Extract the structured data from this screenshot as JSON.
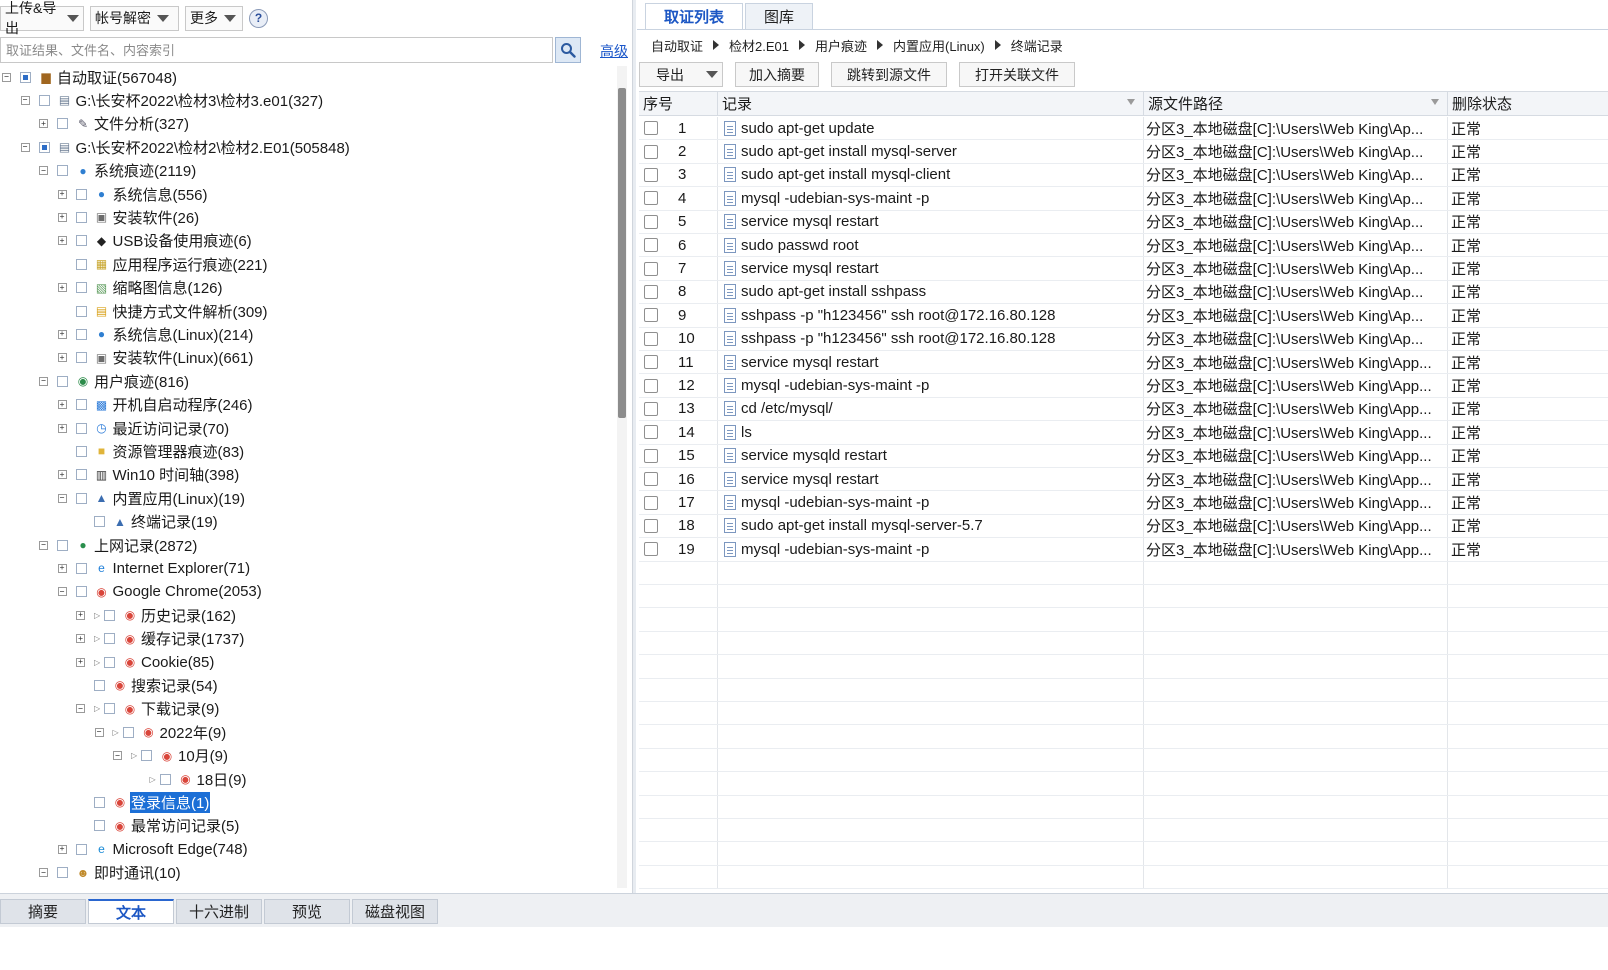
{
  "toolbar": {
    "upload_export": "上传&导出",
    "account_decrypt": "帐号解密",
    "more": "更多",
    "help": "?"
  },
  "search": {
    "placeholder": "取证结果、文件名、内容索引",
    "advanced": "高级"
  },
  "tree": [
    {
      "label": "自动取证(567048)",
      "icon": "case-icon",
      "level": 0,
      "exp": "-"
    },
    {
      "label": "G:\\长安杯2022\\检材3\\检材3.e01(327)",
      "icon": "disk-image-icon",
      "level": 1,
      "exp": "-"
    },
    {
      "label": "文件分析(327)",
      "icon": "file-analysis-icon",
      "level": 2,
      "exp": "+"
    },
    {
      "label": "G:\\长安杯2022\\检材2\\检材2.E01(505848)",
      "icon": "disk-image-icon",
      "level": 1,
      "exp": "-"
    },
    {
      "label": "系统痕迹(2119)",
      "icon": "globe-icon",
      "level": 2,
      "exp": "-"
    },
    {
      "label": "系统信息(556)",
      "icon": "globe-icon",
      "level": 3,
      "exp": "+"
    },
    {
      "label": "安装软件(26)",
      "icon": "install-icon",
      "level": 3,
      "exp": "+"
    },
    {
      "label": "USB设备使用痕迹(6)",
      "icon": "usb-icon",
      "level": 3,
      "exp": "+"
    },
    {
      "label": "应用程序运行痕迹(221)",
      "icon": "app-run-icon",
      "level": 3,
      "exp": ""
    },
    {
      "label": "缩略图信息(126)",
      "icon": "thumbnail-icon",
      "level": 3,
      "exp": "+"
    },
    {
      "label": "快捷方式文件解析(309)",
      "icon": "shortcut-icon",
      "level": 3,
      "exp": ""
    },
    {
      "label": "系统信息(Linux)(214)",
      "icon": "globe-icon",
      "level": 3,
      "exp": "+"
    },
    {
      "label": "安装软件(Linux)(661)",
      "icon": "install-icon",
      "level": 3,
      "exp": "+"
    },
    {
      "label": "用户痕迹(816)",
      "icon": "user-trace-icon",
      "level": 2,
      "exp": "-"
    },
    {
      "label": "开机自启动程序(246)",
      "icon": "startup-icon",
      "level": 3,
      "exp": "+"
    },
    {
      "label": "最近访问记录(70)",
      "icon": "recent-icon",
      "level": 3,
      "exp": "+"
    },
    {
      "label": "资源管理器痕迹(83)",
      "icon": "folder-icon",
      "level": 3,
      "exp": ""
    },
    {
      "label": "Win10 时间轴(398)",
      "icon": "timeline-icon",
      "level": 3,
      "exp": "+"
    },
    {
      "label": "内置应用(Linux)(19)",
      "icon": "linux-app-icon",
      "level": 3,
      "exp": "-"
    },
    {
      "label": "终端记录(19)",
      "icon": "terminal-icon",
      "level": 4,
      "exp": ""
    },
    {
      "label": "上网记录(2872)",
      "icon": "internet-icon",
      "level": 2,
      "exp": "-"
    },
    {
      "label": "Internet Explorer(71)",
      "icon": "ie-icon",
      "level": 3,
      "exp": "+"
    },
    {
      "label": "Google Chrome(2053)",
      "icon": "chrome-icon",
      "level": 3,
      "exp": "-"
    },
    {
      "label": "历史记录(162)",
      "icon": "chrome-icon",
      "level": 4,
      "exp": "+",
      "dot": true
    },
    {
      "label": "缓存记录(1737)",
      "icon": "chrome-icon",
      "level": 4,
      "exp": "+",
      "dot": true
    },
    {
      "label": "Cookie(85)",
      "icon": "chrome-icon",
      "level": 4,
      "exp": "+",
      "dot": true
    },
    {
      "label": "搜索记录(54)",
      "icon": "chrome-icon",
      "level": 4,
      "exp": ""
    },
    {
      "label": "下载记录(9)",
      "icon": "chrome-icon",
      "level": 4,
      "exp": "-",
      "dot": true
    },
    {
      "label": "2022年(9)",
      "icon": "chrome-icon",
      "level": 5,
      "exp": "-",
      "dot": true
    },
    {
      "label": "10月(9)",
      "icon": "chrome-icon",
      "level": 6,
      "exp": "-",
      "dot": true
    },
    {
      "label": "18日(9)",
      "icon": "chrome-icon",
      "level": 7,
      "exp": "",
      "dot": true
    },
    {
      "label": "登录信息(1)",
      "icon": "chrome-icon",
      "level": 4,
      "exp": "",
      "selected": true
    },
    {
      "label": "最常访问记录(5)",
      "icon": "chrome-icon",
      "level": 4,
      "exp": ""
    },
    {
      "label": "Microsoft Edge(748)",
      "icon": "edge-icon",
      "level": 3,
      "exp": "+"
    },
    {
      "label": "即时通讯(10)",
      "icon": "chat-icon",
      "level": 2,
      "exp": "-"
    }
  ],
  "top_tabs": [
    "取证列表",
    "图库"
  ],
  "breadcrumb": [
    "自动取证",
    "检材2.E01",
    "用户痕迹",
    "内置应用(Linux)",
    "终端记录"
  ],
  "actions": {
    "export": "导出",
    "add_summary": "加入摘要",
    "jump_source": "跳转到源文件",
    "open_related": "打开关联文件"
  },
  "grid": {
    "headers": [
      "序号",
      "记录",
      "源文件路径",
      "删除状态"
    ],
    "rows": [
      {
        "no": "1",
        "record": "sudo apt-get update",
        "path": "分区3_本地磁盘[C]:\\Users\\Web King\\Ap...",
        "status": "正常"
      },
      {
        "no": "2",
        "record": "sudo apt-get install mysql-server",
        "path": "分区3_本地磁盘[C]:\\Users\\Web King\\Ap...",
        "status": "正常"
      },
      {
        "no": "3",
        "record": "sudo apt-get install mysql-client",
        "path": "分区3_本地磁盘[C]:\\Users\\Web King\\Ap...",
        "status": "正常"
      },
      {
        "no": "4",
        "record": "mysql -udebian-sys-maint -p",
        "path": "分区3_本地磁盘[C]:\\Users\\Web King\\Ap...",
        "status": "正常"
      },
      {
        "no": "5",
        "record": "service mysql restart",
        "path": "分区3_本地磁盘[C]:\\Users\\Web King\\Ap...",
        "status": "正常"
      },
      {
        "no": "6",
        "record": "sudo passwd root",
        "path": "分区3_本地磁盘[C]:\\Users\\Web King\\Ap...",
        "status": "正常"
      },
      {
        "no": "7",
        "record": "service mysql restart",
        "path": "分区3_本地磁盘[C]:\\Users\\Web King\\Ap...",
        "status": "正常"
      },
      {
        "no": "8",
        "record": "sudo apt-get install sshpass",
        "path": "分区3_本地磁盘[C]:\\Users\\Web King\\Ap...",
        "status": "正常"
      },
      {
        "no": "9",
        "record": "sshpass -p \"h123456\" ssh root@172.16.80.128",
        "path": "分区3_本地磁盘[C]:\\Users\\Web King\\Ap...",
        "status": "正常"
      },
      {
        "no": "10",
        "record": "sshpass -p \"h123456\" ssh root@172.16.80.128",
        "path": "分区3_本地磁盘[C]:\\Users\\Web King\\Ap...",
        "status": "正常"
      },
      {
        "no": "11",
        "record": "service mysql restart",
        "path": "分区3_本地磁盘[C]:\\Users\\Web King\\App...",
        "status": "正常"
      },
      {
        "no": "12",
        "record": "mysql -udebian-sys-maint -p",
        "path": "分区3_本地磁盘[C]:\\Users\\Web King\\App...",
        "status": "正常"
      },
      {
        "no": "13",
        "record": "cd /etc/mysql/",
        "path": "分区3_本地磁盘[C]:\\Users\\Web King\\App...",
        "status": "正常"
      },
      {
        "no": "14",
        "record": "ls",
        "path": "分区3_本地磁盘[C]:\\Users\\Web King\\App...",
        "status": "正常"
      },
      {
        "no": "15",
        "record": "service mysqld restart",
        "path": "分区3_本地磁盘[C]:\\Users\\Web King\\App...",
        "status": "正常"
      },
      {
        "no": "16",
        "record": "service mysql restart",
        "path": "分区3_本地磁盘[C]:\\Users\\Web King\\App...",
        "status": "正常"
      },
      {
        "no": "17",
        "record": "mysql -udebian-sys-maint -p",
        "path": "分区3_本地磁盘[C]:\\Users\\Web King\\App...",
        "status": "正常"
      },
      {
        "no": "18",
        "record": "sudo apt-get install mysql-server-5.7",
        "path": "分区3_本地磁盘[C]:\\Users\\Web King\\App...",
        "status": "正常"
      },
      {
        "no": "19",
        "record": "mysql -udebian-sys-maint -p",
        "path": "分区3_本地磁盘[C]:\\Users\\Web King\\App...",
        "status": "正常"
      }
    ]
  },
  "bottom_tabs": [
    "摘要",
    "文本",
    "十六进制",
    "预览",
    "磁盘视图"
  ],
  "bottom_active": 1,
  "colors": {
    "accent": "#1c57c4",
    "selection": "#1c6fd6"
  }
}
